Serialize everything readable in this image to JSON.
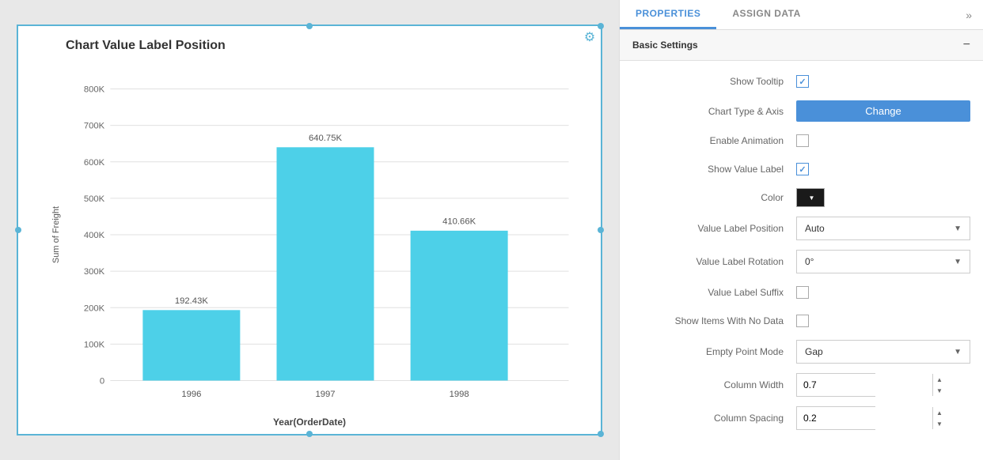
{
  "panel": {
    "tabs": [
      {
        "label": "PROPERTIES",
        "active": true
      },
      {
        "label": "ASSIGN DATA",
        "active": false
      }
    ],
    "expand_icon": "»",
    "section": {
      "title": "Basic Settings",
      "collapse_icon": "−"
    },
    "properties": {
      "show_tooltip": {
        "label": "Show Tooltip",
        "checked": true
      },
      "chart_type_axis": {
        "label": "Chart Type & Axis",
        "button_text": "Change"
      },
      "enable_animation": {
        "label": "Enable Animation",
        "checked": false
      },
      "show_value_label": {
        "label": "Show Value Label",
        "checked": true
      },
      "color": {
        "label": "Color",
        "value": "#1a1a1a"
      },
      "value_label_position": {
        "label": "Value Label Position",
        "value": "Auto"
      },
      "value_label_rotation": {
        "label": "Value Label Rotation",
        "value": "0°"
      },
      "value_label_suffix": {
        "label": "Value Label Suffix",
        "checked": false
      },
      "show_items_no_data": {
        "label": "Show Items With No Data",
        "checked": false
      },
      "empty_point_mode": {
        "label": "Empty Point Mode",
        "value": "Gap"
      },
      "column_width": {
        "label": "Column Width",
        "value": "0.7"
      },
      "column_spacing": {
        "label": "Column Spacing",
        "value": "0.2"
      }
    }
  },
  "chart": {
    "title": "Chart Value Label Position",
    "y_axis_label": "Sum of Freight",
    "x_axis_label": "Year(OrderDate)",
    "y_ticks": [
      "800K",
      "700K",
      "600K",
      "500K",
      "400K",
      "300K",
      "200K",
      "100K",
      "0"
    ],
    "bars": [
      {
        "year": "1996",
        "value": 192430,
        "label": "192.43K",
        "height_pct": 24
      },
      {
        "year": "1997",
        "value": 640750,
        "label": "640.75K",
        "height_pct": 80
      },
      {
        "year": "1998",
        "value": 410660,
        "label": "410.66K",
        "height_pct": 51
      }
    ],
    "max_value": 800000
  }
}
